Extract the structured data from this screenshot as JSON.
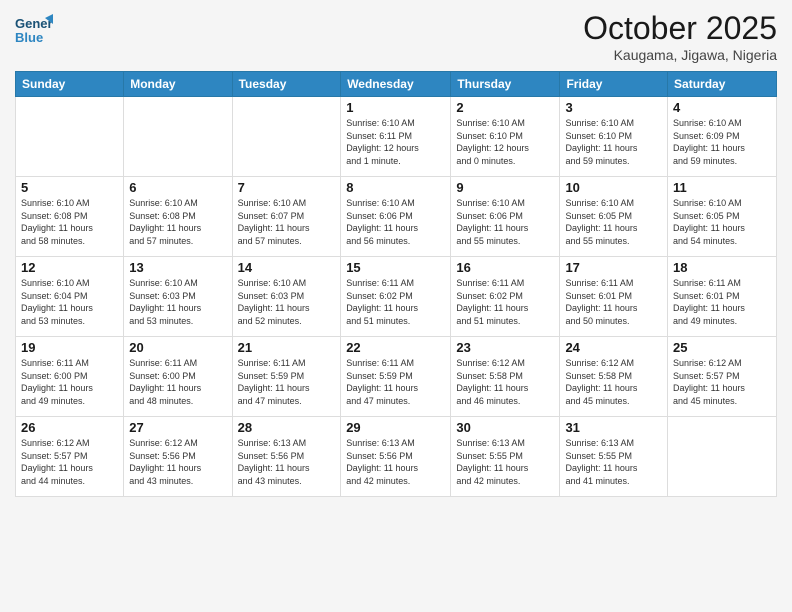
{
  "header": {
    "logo_general": "General",
    "logo_blue": "Blue",
    "month_year": "October 2025",
    "location": "Kaugama, Jigawa, Nigeria"
  },
  "weekdays": [
    "Sunday",
    "Monday",
    "Tuesday",
    "Wednesday",
    "Thursday",
    "Friday",
    "Saturday"
  ],
  "weeks": [
    [
      {
        "day": "",
        "info": ""
      },
      {
        "day": "",
        "info": ""
      },
      {
        "day": "",
        "info": ""
      },
      {
        "day": "1",
        "info": "Sunrise: 6:10 AM\nSunset: 6:11 PM\nDaylight: 12 hours\nand 1 minute."
      },
      {
        "day": "2",
        "info": "Sunrise: 6:10 AM\nSunset: 6:10 PM\nDaylight: 12 hours\nand 0 minutes."
      },
      {
        "day": "3",
        "info": "Sunrise: 6:10 AM\nSunset: 6:10 PM\nDaylight: 11 hours\nand 59 minutes."
      },
      {
        "day": "4",
        "info": "Sunrise: 6:10 AM\nSunset: 6:09 PM\nDaylight: 11 hours\nand 59 minutes."
      }
    ],
    [
      {
        "day": "5",
        "info": "Sunrise: 6:10 AM\nSunset: 6:08 PM\nDaylight: 11 hours\nand 58 minutes."
      },
      {
        "day": "6",
        "info": "Sunrise: 6:10 AM\nSunset: 6:08 PM\nDaylight: 11 hours\nand 57 minutes."
      },
      {
        "day": "7",
        "info": "Sunrise: 6:10 AM\nSunset: 6:07 PM\nDaylight: 11 hours\nand 57 minutes."
      },
      {
        "day": "8",
        "info": "Sunrise: 6:10 AM\nSunset: 6:06 PM\nDaylight: 11 hours\nand 56 minutes."
      },
      {
        "day": "9",
        "info": "Sunrise: 6:10 AM\nSunset: 6:06 PM\nDaylight: 11 hours\nand 55 minutes."
      },
      {
        "day": "10",
        "info": "Sunrise: 6:10 AM\nSunset: 6:05 PM\nDaylight: 11 hours\nand 55 minutes."
      },
      {
        "day": "11",
        "info": "Sunrise: 6:10 AM\nSunset: 6:05 PM\nDaylight: 11 hours\nand 54 minutes."
      }
    ],
    [
      {
        "day": "12",
        "info": "Sunrise: 6:10 AM\nSunset: 6:04 PM\nDaylight: 11 hours\nand 53 minutes."
      },
      {
        "day": "13",
        "info": "Sunrise: 6:10 AM\nSunset: 6:03 PM\nDaylight: 11 hours\nand 53 minutes."
      },
      {
        "day": "14",
        "info": "Sunrise: 6:10 AM\nSunset: 6:03 PM\nDaylight: 11 hours\nand 52 minutes."
      },
      {
        "day": "15",
        "info": "Sunrise: 6:11 AM\nSunset: 6:02 PM\nDaylight: 11 hours\nand 51 minutes."
      },
      {
        "day": "16",
        "info": "Sunrise: 6:11 AM\nSunset: 6:02 PM\nDaylight: 11 hours\nand 51 minutes."
      },
      {
        "day": "17",
        "info": "Sunrise: 6:11 AM\nSunset: 6:01 PM\nDaylight: 11 hours\nand 50 minutes."
      },
      {
        "day": "18",
        "info": "Sunrise: 6:11 AM\nSunset: 6:01 PM\nDaylight: 11 hours\nand 49 minutes."
      }
    ],
    [
      {
        "day": "19",
        "info": "Sunrise: 6:11 AM\nSunset: 6:00 PM\nDaylight: 11 hours\nand 49 minutes."
      },
      {
        "day": "20",
        "info": "Sunrise: 6:11 AM\nSunset: 6:00 PM\nDaylight: 11 hours\nand 48 minutes."
      },
      {
        "day": "21",
        "info": "Sunrise: 6:11 AM\nSunset: 5:59 PM\nDaylight: 11 hours\nand 47 minutes."
      },
      {
        "day": "22",
        "info": "Sunrise: 6:11 AM\nSunset: 5:59 PM\nDaylight: 11 hours\nand 47 minutes."
      },
      {
        "day": "23",
        "info": "Sunrise: 6:12 AM\nSunset: 5:58 PM\nDaylight: 11 hours\nand 46 minutes."
      },
      {
        "day": "24",
        "info": "Sunrise: 6:12 AM\nSunset: 5:58 PM\nDaylight: 11 hours\nand 45 minutes."
      },
      {
        "day": "25",
        "info": "Sunrise: 6:12 AM\nSunset: 5:57 PM\nDaylight: 11 hours\nand 45 minutes."
      }
    ],
    [
      {
        "day": "26",
        "info": "Sunrise: 6:12 AM\nSunset: 5:57 PM\nDaylight: 11 hours\nand 44 minutes."
      },
      {
        "day": "27",
        "info": "Sunrise: 6:12 AM\nSunset: 5:56 PM\nDaylight: 11 hours\nand 43 minutes."
      },
      {
        "day": "28",
        "info": "Sunrise: 6:13 AM\nSunset: 5:56 PM\nDaylight: 11 hours\nand 43 minutes."
      },
      {
        "day": "29",
        "info": "Sunrise: 6:13 AM\nSunset: 5:56 PM\nDaylight: 11 hours\nand 42 minutes."
      },
      {
        "day": "30",
        "info": "Sunrise: 6:13 AM\nSunset: 5:55 PM\nDaylight: 11 hours\nand 42 minutes."
      },
      {
        "day": "31",
        "info": "Sunrise: 6:13 AM\nSunset: 5:55 PM\nDaylight: 11 hours\nand 41 minutes."
      },
      {
        "day": "",
        "info": ""
      }
    ]
  ]
}
